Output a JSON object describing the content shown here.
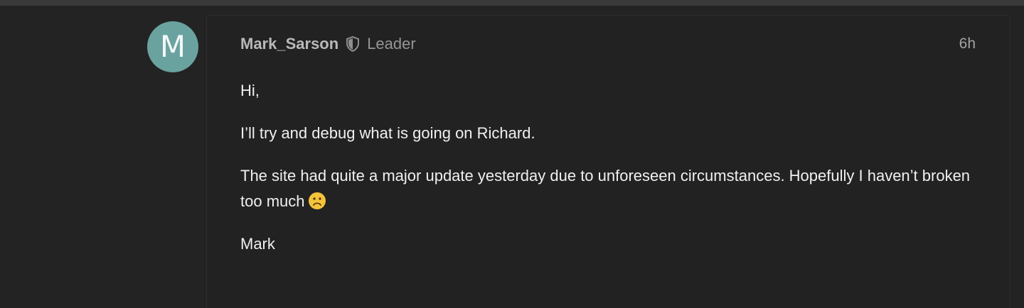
{
  "post": {
    "author": {
      "initial": "M",
      "username": "Mark_Sarson",
      "role": "Leader",
      "avatar_color": "#6aa29f",
      "badge_icon": "shield-icon"
    },
    "time": "6h",
    "body": {
      "greeting": "Hi,",
      "line1": "I’ll try and debug what is going on Richard.",
      "line2": "The site had quite a major update yesterday due to unforeseen circumstances. Hopefully I haven’t broken too much",
      "emoji": "frowning-face-emoji",
      "signoff": "Mark"
    }
  },
  "colors": {
    "background": "#232323",
    "card": "#222222",
    "text": "#f0f0f0",
    "muted": "#959595"
  }
}
